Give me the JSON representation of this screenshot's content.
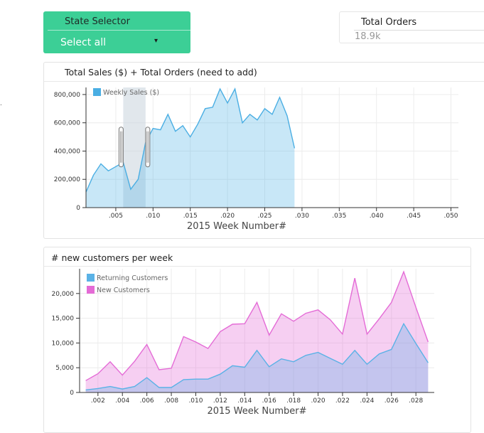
{
  "state_selector": {
    "title": "State Selector",
    "value": "Select all",
    "caret": "▾"
  },
  "total_orders": {
    "title": "Total Orders",
    "value": "18.9k"
  },
  "sales_panel": {
    "title": "Total Sales ($) + Total Orders (need to add)"
  },
  "customers_panel": {
    "title": "# new customers per week"
  },
  "stray_mark": ".",
  "chart_data": [
    {
      "type": "area",
      "xlabel": "2015 Week Number#",
      "ylabel": "",
      "xlim": [
        0.001,
        0.051
      ],
      "ylim": [
        0,
        850000
      ],
      "xticks": [
        ".005",
        ".010",
        ".015",
        ".020",
        ".025",
        ".030",
        ".035",
        ".040",
        ".045",
        ".050"
      ],
      "yticks": [
        "0",
        "200,000",
        "400,000",
        "600,000",
        "800,000"
      ],
      "legend_position": "top-left",
      "grid": true,
      "brush": {
        "from": 0.006,
        "to": 0.009
      },
      "series": [
        {
          "name": "Weekly Sales ($)",
          "color": "#4aaee3",
          "x": [
            0.001,
            0.002,
            0.003,
            0.004,
            0.005,
            0.006,
            0.007,
            0.008,
            0.009,
            0.01,
            0.011,
            0.012,
            0.013,
            0.014,
            0.015,
            0.016,
            0.017,
            0.018,
            0.019,
            0.02,
            0.021,
            0.022,
            0.023,
            0.024,
            0.025,
            0.026,
            0.027,
            0.028,
            0.029
          ],
          "values": [
            110000,
            230000,
            310000,
            260000,
            290000,
            320000,
            130000,
            200000,
            460000,
            560000,
            550000,
            660000,
            540000,
            580000,
            500000,
            590000,
            700000,
            710000,
            840000,
            740000,
            840000,
            600000,
            660000,
            620000,
            700000,
            660000,
            780000,
            650000,
            420000
          ]
        }
      ]
    },
    {
      "type": "area",
      "xlabel": "2015 Week Number#",
      "ylabel": "",
      "xlim": [
        0.0005,
        0.0295
      ],
      "ylim": [
        0,
        25000
      ],
      "xticks": [
        ".002",
        ".004",
        ".006",
        ".008",
        ".010",
        ".012",
        ".014",
        ".016",
        ".018",
        ".020",
        ".022",
        ".024",
        ".026",
        ".028"
      ],
      "yticks": [
        "0",
        "5,000",
        "10,000",
        "15,000",
        "20,000"
      ],
      "legend_position": "top-left",
      "grid": true,
      "series": [
        {
          "name": "Returning Customers",
          "color": "#5ab2e6",
          "x": [
            0.001,
            0.002,
            0.003,
            0.004,
            0.005,
            0.006,
            0.007,
            0.008,
            0.009,
            0.01,
            0.011,
            0.012,
            0.013,
            0.014,
            0.015,
            0.016,
            0.017,
            0.018,
            0.019,
            0.02,
            0.021,
            0.022,
            0.023,
            0.024,
            0.025,
            0.026,
            0.027,
            0.028,
            0.029
          ],
          "values": [
            500,
            800,
            1200,
            700,
            1200,
            3000,
            1000,
            1000,
            2600,
            2700,
            2700,
            3700,
            5400,
            5100,
            8500,
            5200,
            6800,
            6200,
            7500,
            8100,
            6900,
            5700,
            8500,
            5700,
            7800,
            8700,
            13900,
            9900,
            6000
          ]
        },
        {
          "name": "New Customers",
          "color": "#e46bd6",
          "x": [
            0.001,
            0.002,
            0.003,
            0.004,
            0.005,
            0.006,
            0.007,
            0.008,
            0.009,
            0.01,
            0.011,
            0.012,
            0.013,
            0.014,
            0.015,
            0.016,
            0.017,
            0.018,
            0.019,
            0.02,
            0.021,
            0.022,
            0.023,
            0.024,
            0.025,
            0.026,
            0.027,
            0.028,
            0.029
          ],
          "values": [
            2400,
            3800,
            6200,
            3500,
            6300,
            9700,
            4600,
            4900,
            11300,
            10200,
            8900,
            12300,
            13800,
            13900,
            18200,
            11600,
            15900,
            14400,
            16000,
            16700,
            14700,
            11800,
            23100,
            11800,
            14900,
            18200,
            24400,
            17200,
            10200
          ]
        }
      ]
    }
  ]
}
